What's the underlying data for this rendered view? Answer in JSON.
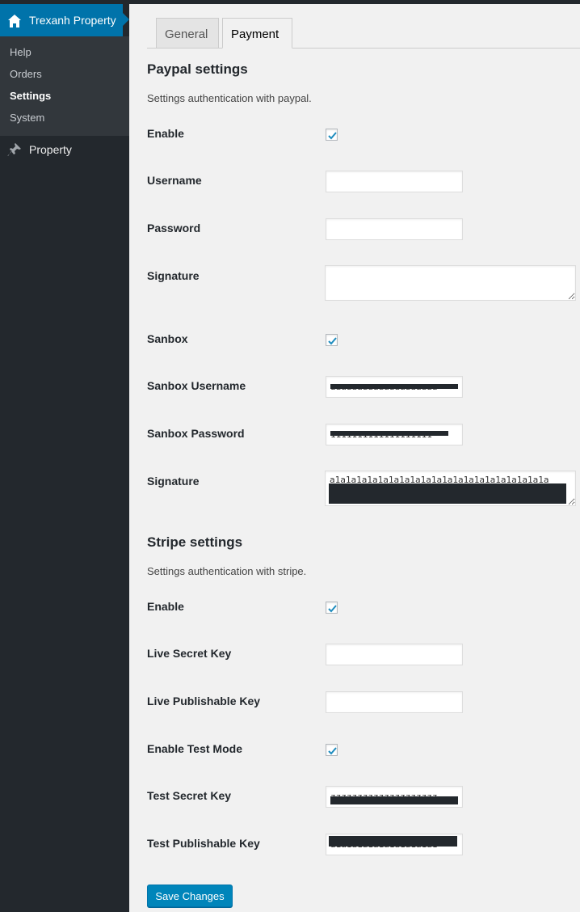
{
  "sidebar": {
    "current_menu": "Trexanh Property",
    "submenu": [
      "Help",
      "Orders",
      "Settings",
      "System"
    ],
    "active_submenu": "Settings",
    "property_menu": "Property",
    "home_icon": "home-icon",
    "pin_icon": "pin-icon"
  },
  "tabs": [
    "General",
    "Payment"
  ],
  "active_tab": "Payment",
  "paypal": {
    "title": "Paypal settings",
    "description": "Settings authentication with paypal.",
    "enable_label": "Enable",
    "enable_checked": true,
    "username_label": "Username",
    "username_value": "",
    "password_label": "Password",
    "password_value": "",
    "signature_label": "Signature",
    "signature_value": "",
    "sandbox_label": "Sanbox",
    "sandbox_checked": true,
    "sandbox_username_label": "Sanbox Username",
    "sandbox_username_value": "aaaaaaaaaaaaaaaaaaaa",
    "sandbox_password_label": "Sanbox Password",
    "sandbox_password_value": "1111111111111111111",
    "sandbox_signature_label": "Signature",
    "sandbox_signature_value": "a1a1a1a1a1a1a1a1a1a1a1a1a1a1a1a1a1a1a1a1a"
  },
  "stripe": {
    "title": "Stripe settings",
    "description": "Settings authentication with stripe.",
    "enable_label": "Enable",
    "enable_checked": true,
    "live_secret_label": "Live Secret Key",
    "live_secret_value": "",
    "live_publishable_label": "Live Publishable Key",
    "live_publishable_value": "",
    "test_mode_label": "Enable Test Mode",
    "test_mode_checked": true,
    "test_secret_label": "Test Secret Key",
    "test_secret_value": "zzzzzzzzzzzzzzzzzzzz",
    "test_publishable_label": "Test Publishable Key",
    "test_publishable_value": "a1a1a1a1a1a1a1a1a1a1"
  },
  "save_label": "Save Changes",
  "colors": {
    "sidebar": "#23282d",
    "submenu": "#32373c",
    "accent": "#0073aa",
    "button": "#0085ba",
    "checkmark": "#1e8cbe",
    "background": "#f1f1f1"
  }
}
